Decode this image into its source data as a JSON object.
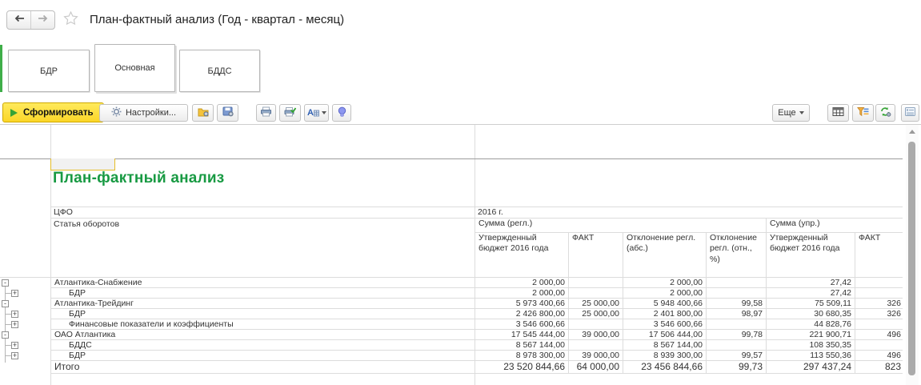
{
  "window": {
    "title": "План-фактный анализ (Год - квартал - месяц)"
  },
  "nav": {
    "icons": [
      "back-arrow-icon",
      "forward-arrow-icon",
      "star-icon"
    ]
  },
  "tabs": [
    {
      "label": "БДР",
      "active": false
    },
    {
      "label": "Основная",
      "active": true
    },
    {
      "label": "БДДС",
      "active": false
    }
  ],
  "toolbar": {
    "generate_label": "Сформировать",
    "settings_label": "Настройки...",
    "more_label": "Еще",
    "left_icons": [
      "play-icon",
      "gear-icon",
      "load-settings-icon",
      "save-settings-icon",
      "print-icon",
      "print-check-icon",
      "format-icon",
      "caret-down-icon",
      "bulb-icon"
    ],
    "right_icons": [
      "table-settings-icon",
      "report-structure-icon",
      "change-variant-icon",
      "side-panel-icon"
    ]
  },
  "report": {
    "title": "План-фактный анализ",
    "cfo_label": "ЦФО",
    "article_label": "Статья оборотов",
    "period": "2016 г.",
    "groups": [
      {
        "label": "Сумма (регл.)"
      },
      {
        "label": "Сумма (упр.)"
      }
    ],
    "columns": [
      "Утвержденный бюджет 2016 года",
      "ФАКТ",
      "Отклонение регл. (абс.)",
      "Отклонение регл. (отн., %)",
      "Утвержденный бюджет 2016  года",
      "ФАКТ"
    ],
    "rows": [
      {
        "name": "Атлантика-Снабжение",
        "level": 0,
        "expander": "minus",
        "total": false,
        "values": [
          "2 000,00",
          "",
          "2 000,00",
          "",
          "27,42",
          ""
        ]
      },
      {
        "name": "БДР",
        "level": 1,
        "expander": "plus",
        "total": false,
        "values": [
          "2 000,00",
          "",
          "2 000,00",
          "",
          "27,42",
          ""
        ]
      },
      {
        "name": "Атлантика-Трейдинг",
        "level": 0,
        "expander": "minus",
        "total": false,
        "values": [
          "5 973 400,66",
          "25 000,00",
          "5 948 400,66",
          "99,58",
          "75 509,11",
          "326"
        ]
      },
      {
        "name": "БДР",
        "level": 1,
        "expander": "plus",
        "total": false,
        "values": [
          "2 426 800,00",
          "25 000,00",
          "2 401 800,00",
          "98,97",
          "30 680,35",
          "326"
        ]
      },
      {
        "name": "Финансовые показатели и коэффициенты",
        "level": 1,
        "expander": "plus",
        "total": false,
        "values": [
          "3 546 600,66",
          "",
          "3 546 600,66",
          "",
          "44 828,76",
          ""
        ]
      },
      {
        "name": "ОАО Атлантика",
        "level": 0,
        "expander": "minus",
        "total": false,
        "values": [
          "17 545 444,00",
          "39 000,00",
          "17 506 444,00",
          "99,78",
          "221 900,71",
          "496"
        ]
      },
      {
        "name": "БДДС",
        "level": 1,
        "expander": "plus",
        "total": false,
        "values": [
          "8 567 144,00",
          "",
          "8 567 144,00",
          "",
          "108 350,35",
          ""
        ]
      },
      {
        "name": "БДР",
        "level": 1,
        "expander": "plus",
        "total": false,
        "values": [
          "8 978 300,00",
          "39 000,00",
          "8 939 300,00",
          "99,57",
          "113 550,36",
          "496"
        ]
      },
      {
        "name": "Итого",
        "level": 0,
        "expander": "none",
        "total": true,
        "values": [
          "23 520 844,66",
          "64 000,00",
          "23 456 844,66",
          "99,73",
          "297 437,24",
          "823"
        ]
      }
    ]
  },
  "colors": {
    "accent_green": "#189a43",
    "tab_accent_green": "#3fae49",
    "button_yellow": "#fbd628",
    "button_yellow_border": "#cfa900",
    "selection_yellow": "#e5bd28",
    "grid_line": "#dcdcdc",
    "section_line": "#9c9c9c"
  }
}
